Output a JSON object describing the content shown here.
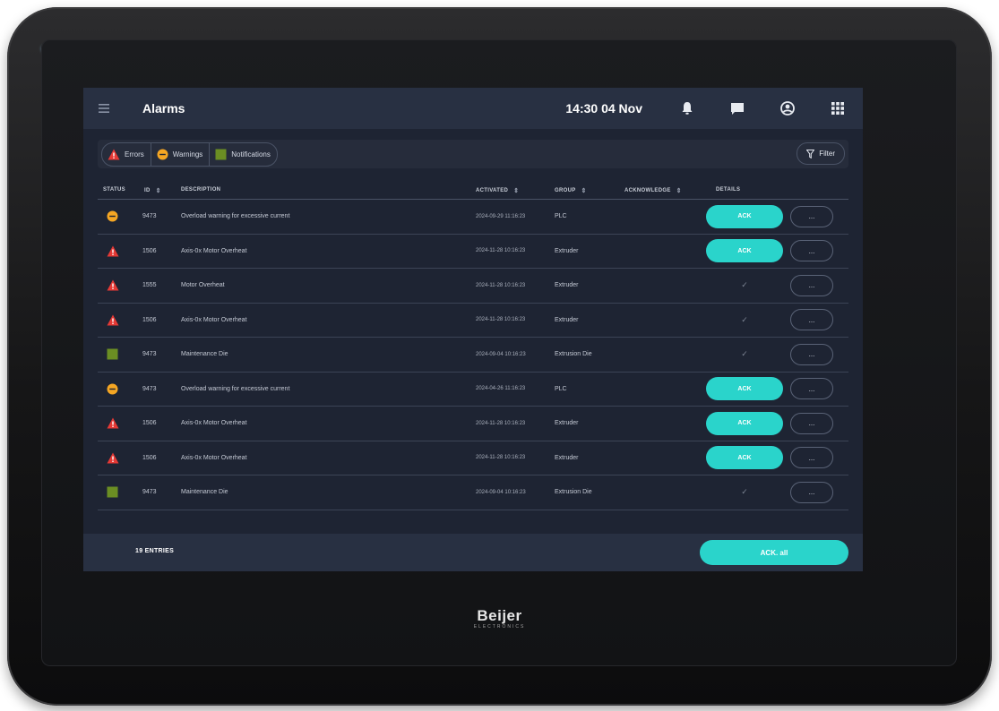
{
  "header": {
    "title": "Alarms",
    "time": "14:30",
    "date": "04 Nov",
    "icons": [
      "menu-icon",
      "bell-icon",
      "chat-icon",
      "user-icon",
      "apps-grid-icon"
    ]
  },
  "filters": {
    "errors_label": "Errors",
    "warnings_label": "Warnings",
    "notifications_label": "Notifications",
    "filter_label": "Filter"
  },
  "table": {
    "columns": {
      "status": "STATUS",
      "id": "ID",
      "description": "DESCRIPTION",
      "activated": "ACTIVATED",
      "group": "GROUP",
      "acknowledge": "ACKNOWLEDGE",
      "details": "DETAILS"
    },
    "rows": [
      {
        "status": "warning",
        "id": "9473",
        "description": "Overload warning for excessive current",
        "activated": "2024-09-29 11:16:23",
        "group": "PLC",
        "ack_label": "ACK",
        "details_label": "...",
        "acknowledged": false
      },
      {
        "status": "error",
        "id": "1506",
        "description": "Axis-0x Motor Overheat",
        "activated": "2024-11-28 10:16:23",
        "group": "Extruder",
        "ack_label": "ACK",
        "details_label": "...",
        "acknowledged": false
      },
      {
        "status": "error",
        "id": "1555",
        "description": "Motor Overheat",
        "activated": "2024-11-28 10:16:23",
        "group": "Extruder",
        "ack_label": "✓",
        "details_label": "...",
        "acknowledged": true
      },
      {
        "status": "error",
        "id": "1506",
        "description": "Axis-0x Motor Overheat",
        "activated": "2024-11-28 10:16:23",
        "group": "Extruder",
        "ack_label": "✓",
        "details_label": "...",
        "acknowledged": true
      },
      {
        "status": "notification",
        "id": "9473",
        "description": "Maintenance Die",
        "activated": "2024-09-04 10:16:23",
        "group": "Extrusion Die",
        "ack_label": "✓",
        "details_label": "...",
        "acknowledged": true
      },
      {
        "status": "warning",
        "id": "9473",
        "description": "Overload warning for excessive current",
        "activated": "2024-04-26 11:16:23",
        "group": "PLC",
        "ack_label": "ACK",
        "details_label": "...",
        "acknowledged": false
      },
      {
        "status": "error",
        "id": "1506",
        "description": "Axis-0x Motor Overheat",
        "activated": "2024-11-28 10:16:23",
        "group": "Extruder",
        "ack_label": "ACK",
        "details_label": "...",
        "acknowledged": false
      },
      {
        "status": "error",
        "id": "1506",
        "description": "Axis-0x Motor Overheat",
        "activated": "2024-11-28 10:16:23",
        "group": "Extruder",
        "ack_label": "ACK",
        "details_label": "...",
        "acknowledged": false
      },
      {
        "status": "notification",
        "id": "9473",
        "description": "Maintenance Die",
        "activated": "2024-09-04 10:16:23",
        "group": "Extrusion Die",
        "ack_label": "✓",
        "details_label": "...",
        "acknowledged": true
      }
    ]
  },
  "footer": {
    "entries_label": "19 ENTRIES",
    "ack_all_label": "ACK. all"
  },
  "device": {
    "brand": "Beijer",
    "brand_sub": "ELECTRONICS"
  },
  "colors": {
    "accent": "#2ad4cb",
    "error": "#e53935",
    "warning": "#f5a623",
    "notification": "#6b8e23",
    "background": "#1e2433",
    "bar": "#283042"
  }
}
